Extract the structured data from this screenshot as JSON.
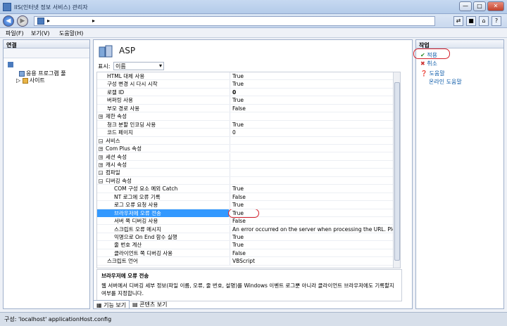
{
  "window": {
    "title": "IIS(인터넷 정보 서비스) 관리자",
    "min": "—",
    "max": "□",
    "close": "✕"
  },
  "address": {
    "back": "◀",
    "forward": "▶",
    "path_arrow": "▸"
  },
  "menu": {
    "file": "파일(F)",
    "view": "보기(V)",
    "help": "도움말(H)"
  },
  "connections": {
    "header": "연결",
    "items": [
      {
        "label": "응용 프로그램 풀"
      },
      {
        "label": "사이트"
      }
    ]
  },
  "feature": {
    "title": "ASP",
    "display_label": "표시:",
    "display_value": "이름"
  },
  "grid_rows": [
    {
      "name": "HTML 대체 사용",
      "value": "True",
      "kind": "indent"
    },
    {
      "name": "구성 변경 시 다시 시작",
      "value": "True",
      "kind": "indent"
    },
    {
      "name": "로캘 ID",
      "value": "0",
      "kind": "indent",
      "bold": true
    },
    {
      "name": "버퍼링 사용",
      "value": "True",
      "kind": "indent"
    },
    {
      "name": "부모 경로 사용",
      "value": "False",
      "kind": "indent"
    },
    {
      "name": "제한 속성",
      "value": "",
      "kind": "cat",
      "exp": "+"
    },
    {
      "name": "청크 분할 인코딩 사용",
      "value": "True",
      "kind": "indent"
    },
    {
      "name": "코드 페이지",
      "value": "0",
      "kind": "indent"
    },
    {
      "name": "서비스",
      "value": "",
      "kind": "cat",
      "exp": "−"
    },
    {
      "name": "Com Plus 속성",
      "value": "",
      "kind": "cat",
      "exp": "+"
    },
    {
      "name": "세션 속성",
      "value": "",
      "kind": "cat",
      "exp": "+"
    },
    {
      "name": "캐시 속성",
      "value": "",
      "kind": "cat",
      "exp": "+"
    },
    {
      "name": "컴파일",
      "value": "",
      "kind": "cat",
      "exp": "−"
    },
    {
      "name": "디버깅 속성",
      "value": "",
      "kind": "cat",
      "exp": "−"
    },
    {
      "name": "COM 구성 요소 예외 Catch",
      "value": "True",
      "kind": "indent2"
    },
    {
      "name": "NT 로그에 오류 기록",
      "value": "False",
      "kind": "indent2"
    },
    {
      "name": "로그 오류 요청 사용",
      "value": "True",
      "kind": "indent2"
    },
    {
      "name": "브라우저에 오류 전송",
      "value": "True",
      "kind": "sel"
    },
    {
      "name": "서버 쪽 디버깅 사용",
      "value": "False",
      "kind": "indent2"
    },
    {
      "name": "스크립트 오류 메시지",
      "value": "An error occurred on the server when processing the URL. Please co",
      "kind": "indent2"
    },
    {
      "name": "익명으로 On End 함수 실행",
      "value": "True",
      "kind": "indent2"
    },
    {
      "name": "줄 번호 계산",
      "value": "True",
      "kind": "indent2"
    },
    {
      "name": "클라이언트 쪽 디버깅 사용",
      "value": "False",
      "kind": "indent2"
    },
    {
      "name": "스크립트 언어",
      "value": "VBScript",
      "kind": "indent"
    }
  ],
  "description": {
    "title": "브라우저에 오류 전송",
    "text": "웹 서버에서 디버깅 세부 정보(파일 이름, 오류, 줄 번호, 설명)를 Windows 이벤트 로그뿐 아니라 클라이언트 브라우저에도 기록할지 여부를 지정합니다."
  },
  "tabs": {
    "features": "기능 보기",
    "content": "콘텐츠 보기"
  },
  "actions": {
    "header": "작업",
    "apply": "적용",
    "cancel": "취소",
    "help": "도움말",
    "online_help": "온라인 도움말"
  },
  "status": {
    "text": "구성: 'localhost' applicationHost.config"
  },
  "colors": {
    "selection": "#3399ff",
    "highlight_oval": "#d4202a",
    "link": "#0b5aa8"
  }
}
